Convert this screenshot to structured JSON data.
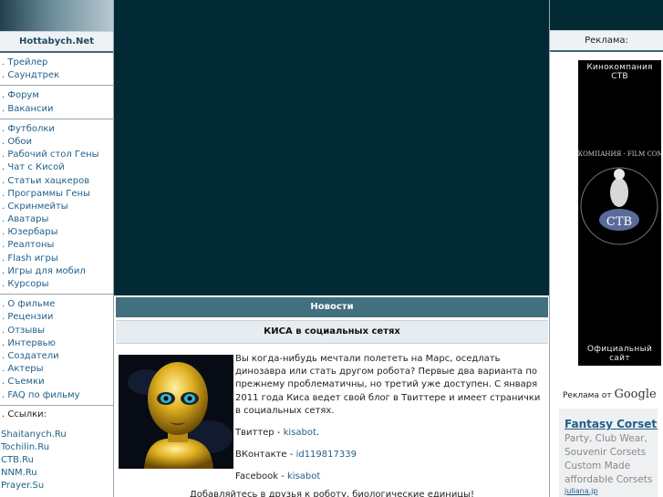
{
  "left_nav": {
    "site_name": "Hottabych.Net",
    "groups": [
      [
        ". Трейлер",
        ". Саундтрек"
      ],
      [
        ". Форум",
        ". Вакансии"
      ],
      [
        ". Футболки",
        ". Обои",
        ". Рабочий стол Гены",
        ". Чат с Кисой",
        ". Статьи хацкеров",
        ". Программы Гены",
        ". Скринмейты",
        ". Аватары",
        ". Юзербары",
        ". Реалтоны",
        ". Flash игры",
        ". Игры для мобил",
        ". Курсоры"
      ],
      [
        ". О фильме",
        ". Рецензии",
        ". Отзывы",
        ". Интервью",
        ". Создатели",
        ". Актеры",
        ". Съемки",
        ". FAQ по фильму"
      ]
    ],
    "links_label": ". Ссылки:",
    "links": [
      "Shaitanych.Ru",
      "Tochilin.Ru",
      "CTB.Ru",
      "NNM.Ru",
      "Prayer.Su"
    ]
  },
  "main": {
    "section_title": "Новости",
    "article": {
      "title": "КИСА в социальных сетях",
      "intro": "Вы когда-нибудь мечтали полететь на Марс, оседлать динозавра или стать другом робота? Первые два варианта по прежнему проблематичны, но третий уже доступен. С января 2011 года Киса ведет свой блог в Твиттере и имеет странички в социальных сетях.",
      "twitter_label": "Твиттер -",
      "twitter_link": "kisabot",
      "vk_label": "ВКонтакте -",
      "vk_link": "id119817339",
      "fb_label": "Facebook -",
      "fb_link": "kisabot",
      "footer": "Добавляйтесь в друзья к роботу, биологические единицы!"
    }
  },
  "right": {
    "ads_label": "Реклама:",
    "ctb": {
      "top": "Кинокомпания СТВ",
      "ring_text": "КИНОКОМПАНИЯ · FILM COMPANY",
      "logo": "СТВ",
      "bottom": "Официальный сайт"
    },
    "google_prefix": "Реклама от",
    "google_brand": "Google",
    "ad": {
      "title": "Fantasy Corsets",
      "body": "Party, Club Wear, Souvenir Corsets Custom Made affordable Corsets",
      "url": "juliana.jp"
    }
  },
  "colors": {
    "banner": "#022a35",
    "bar": "#41707f",
    "link": "#1f5f8a"
  }
}
